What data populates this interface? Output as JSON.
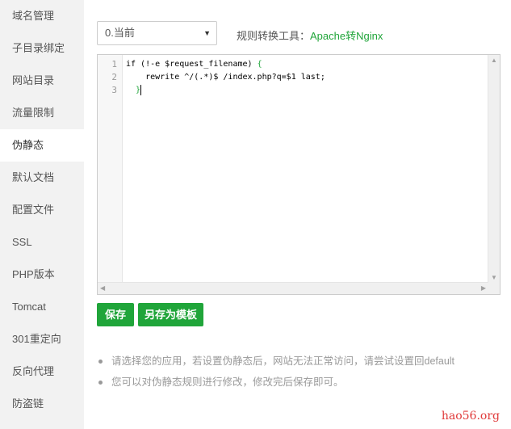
{
  "sidebar": {
    "items": [
      {
        "label": "域名管理"
      },
      {
        "label": "子目录绑定"
      },
      {
        "label": "网站目录"
      },
      {
        "label": "流量限制"
      },
      {
        "label": "伪静态",
        "active": true
      },
      {
        "label": "默认文档"
      },
      {
        "label": "配置文件"
      },
      {
        "label": "SSL"
      },
      {
        "label": "PHP版本"
      },
      {
        "label": "Tomcat"
      },
      {
        "label": "301重定向"
      },
      {
        "label": "反向代理"
      },
      {
        "label": "防盗链"
      }
    ]
  },
  "toolbar": {
    "select_value": "0.当前",
    "tool_label": "规则转换工具：",
    "tool_link": "Apache转Nginx"
  },
  "editor": {
    "lines": [
      {
        "num": "1",
        "text": "if (!-e $request_filename) ",
        "brace": "{"
      },
      {
        "num": "2",
        "text": "    rewrite ^/(.*)$ /index.php?q=$1 last;",
        "brace": ""
      },
      {
        "num": "3",
        "text": "  ",
        "brace": "}"
      }
    ]
  },
  "buttons": {
    "save": "保存",
    "save_template": "另存为模板"
  },
  "notes": [
    "请选择您的应用，若设置伪静态后，网站无法正常访问，请尝试设置回default",
    "您可以对伪静态规则进行修改，修改完后保存即可。"
  ],
  "watermark": "hao56.org",
  "colors": {
    "accent": "#20a53a",
    "sidebar_bg": "#f2f2f2"
  }
}
